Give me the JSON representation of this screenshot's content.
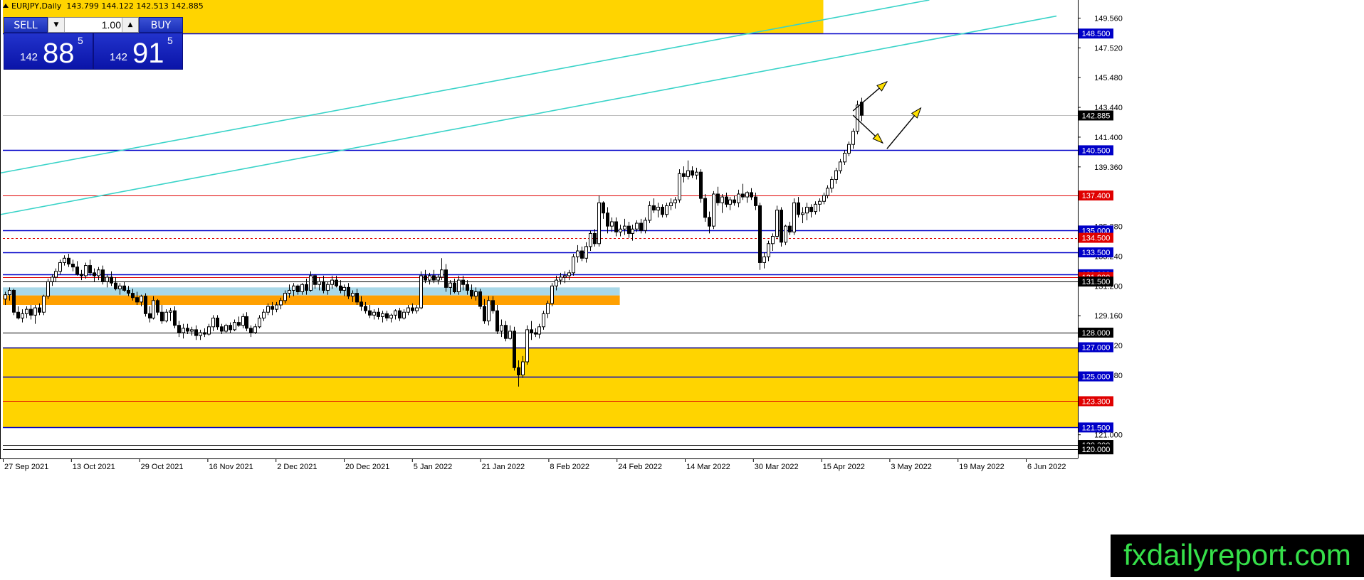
{
  "window": {
    "title": "EURJPY,Daily",
    "ohlc": "143.799 144.122 142.513 142.885"
  },
  "trade_panel": {
    "sell_label": "SELL",
    "buy_label": "BUY",
    "lot_size": "1.00",
    "bid": {
      "prefix": "142",
      "big": "88",
      "sup": "5"
    },
    "ask": {
      "prefix": "142",
      "big": "91",
      "sup": "5"
    }
  },
  "watermark": "fxdailyreport.com",
  "colors": {
    "zone_gold": "#ffd400",
    "zone_orange": "#ffa000",
    "zone_lightblue": "#a9d8e8",
    "line_blue": "#0000c8",
    "line_red": "#e00000",
    "channel_cyan": "#39d3c8",
    "label_blue_bg": "#0000c8",
    "label_red_bg": "#e00000",
    "label_black_bg": "#000000",
    "arrow_yellow": "#ffe000"
  },
  "chart_data": {
    "type": "candlestick",
    "symbol": "EURJPY",
    "timeframe": "Daily",
    "ylim": [
      119.6,
      150.8
    ],
    "x_ticks": [
      "27 Sep 2021",
      "13 Oct 2021",
      "29 Oct 2021",
      "16 Nov 2021",
      "2 Dec 2021",
      "20 Dec 2021",
      "5 Jan 2022",
      "21 Jan 2022",
      "8 Feb 2022",
      "24 Feb 2022",
      "14 Mar 2022",
      "30 Mar 2022",
      "15 Apr 2022",
      "3 May 2022",
      "19 May 2022",
      "6 Jun 2022"
    ],
    "y_ticks": [
      "149.560",
      "147.520",
      "145.480",
      "143.440",
      "141.400",
      "139.360",
      "135.280",
      "133.240",
      "131.200",
      "129.160",
      "127.120",
      "125.080",
      "121.000"
    ],
    "current_price": "142.885",
    "levels": [
      {
        "label": "148.500",
        "value": 148.5,
        "style": "blue"
      },
      {
        "label": "140.500",
        "value": 140.5,
        "style": "blue"
      },
      {
        "label": "137.400",
        "value": 137.4,
        "style": "red"
      },
      {
        "label": "135.000",
        "value": 135.0,
        "style": "blue"
      },
      {
        "label": "134.500",
        "value": 134.5,
        "style": "red-dash"
      },
      {
        "label": "133.500",
        "value": 133.5,
        "style": "blue"
      },
      {
        "label": "132.000",
        "value": 132.0,
        "style": "blue"
      },
      {
        "label": "131.800",
        "value": 131.8,
        "style": "red"
      },
      {
        "label": "131.500",
        "value": 131.5,
        "style": "black"
      },
      {
        "label": "128.000",
        "value": 128.0,
        "style": "black"
      },
      {
        "label": "127.000",
        "value": 127.0,
        "style": "blue"
      },
      {
        "label": "125.000",
        "value": 125.0,
        "style": "blue"
      },
      {
        "label": "123.300",
        "value": 123.3,
        "style": "red"
      },
      {
        "label": "121.500",
        "value": 121.5,
        "style": "blue"
      },
      {
        "label": "120.300",
        "value": 120.3,
        "style": "black"
      },
      {
        "label": "120.000",
        "value": 120.0,
        "style": "black"
      }
    ],
    "zones": [
      {
        "name": "top-gold",
        "from_price": 148.5,
        "to_price": 150.8,
        "color": "gold",
        "extends_to_day": 193
      },
      {
        "name": "bottom-gold",
        "from_price": 121.5,
        "to_price": 127.0,
        "color": "gold"
      },
      {
        "name": "light-blue-band",
        "from_price": 130.55,
        "to_price": 131.1,
        "color": "lightblue",
        "extends_to_day": 145
      },
      {
        "name": "orange-band",
        "from_price": 129.9,
        "to_price": 130.55,
        "color": "orange",
        "extends_to_day": 145
      }
    ],
    "channel_lines": [
      {
        "from": {
          "day": -1,
          "price": 138.95
        },
        "to": {
          "day": 218,
          "price": 150.8
        }
      },
      {
        "from": {
          "day": -1,
          "price": 136.1
        },
        "to": {
          "day": 248,
          "price": 149.7
        }
      }
    ],
    "arrows": [
      {
        "from": {
          "day": 200,
          "price": 143.2
        },
        "to": {
          "day": 208,
          "price": 145.2
        }
      },
      {
        "from": {
          "day": 200,
          "price": 142.9
        },
        "to": {
          "day": 207,
          "price": 141.0
        }
      },
      {
        "from": {
          "day": 208,
          "price": 140.6
        },
        "to": {
          "day": 216,
          "price": 143.4
        }
      }
    ],
    "candles": [
      [
        130.3,
        130.8,
        129.9,
        130.6
      ],
      [
        130.6,
        131.1,
        130.2,
        130.9
      ],
      [
        130.9,
        131.0,
        129.2,
        129.4
      ],
      [
        129.4,
        129.8,
        128.9,
        129.0
      ],
      [
        129.0,
        129.6,
        128.7,
        129.3
      ],
      [
        129.3,
        129.8,
        129.0,
        129.6
      ],
      [
        129.6,
        129.9,
        128.9,
        129.2
      ],
      [
        129.2,
        129.9,
        128.6,
        129.7
      ],
      [
        129.7,
        130.0,
        129.2,
        129.4
      ],
      [
        129.4,
        130.6,
        129.2,
        130.5
      ],
      [
        130.5,
        131.7,
        130.3,
        131.5
      ],
      [
        131.5,
        132.0,
        131.2,
        131.8
      ],
      [
        131.8,
        132.4,
        131.5,
        132.2
      ],
      [
        132.2,
        133.0,
        132.0,
        132.8
      ],
      [
        132.8,
        133.3,
        132.6,
        133.1
      ],
      [
        133.1,
        133.4,
        132.5,
        132.7
      ],
      [
        132.7,
        133.0,
        132.2,
        132.5
      ],
      [
        132.5,
        132.9,
        131.9,
        132.0
      ],
      [
        132.0,
        132.3,
        131.6,
        131.9
      ],
      [
        131.9,
        132.8,
        131.7,
        132.6
      ],
      [
        132.6,
        133.0,
        131.9,
        132.1
      ],
      [
        132.1,
        132.4,
        131.5,
        131.9
      ],
      [
        131.9,
        132.5,
        131.6,
        132.3
      ],
      [
        132.3,
        132.6,
        131.3,
        131.5
      ],
      [
        131.5,
        132.0,
        131.1,
        131.8
      ],
      [
        131.8,
        132.2,
        131.2,
        131.4
      ],
      [
        131.4,
        131.8,
        130.9,
        131.0
      ],
      [
        131.0,
        131.4,
        130.6,
        131.2
      ],
      [
        131.2,
        131.5,
        130.8,
        130.9
      ],
      [
        130.9,
        131.2,
        130.5,
        130.7
      ],
      [
        130.7,
        131.0,
        130.2,
        130.4
      ],
      [
        130.4,
        130.8,
        129.9,
        130.1
      ],
      [
        130.1,
        130.6,
        129.8,
        130.5
      ],
      [
        130.5,
        130.7,
        129.1,
        129.3
      ],
      [
        129.3,
        129.8,
        128.7,
        129.0
      ],
      [
        129.0,
        130.5,
        128.9,
        130.2
      ],
      [
        130.2,
        130.3,
        129.2,
        129.4
      ],
      [
        129.4,
        129.9,
        128.6,
        128.8
      ],
      [
        128.8,
        129.6,
        128.7,
        129.4
      ],
      [
        129.4,
        129.7,
        128.8,
        129.5
      ],
      [
        129.5,
        129.8,
        128.3,
        128.5
      ],
      [
        128.5,
        128.8,
        127.7,
        128.0
      ],
      [
        128.0,
        128.6,
        127.6,
        128.3
      ],
      [
        128.3,
        128.6,
        127.9,
        128.1
      ],
      [
        128.1,
        128.4,
        127.8,
        128.2
      ],
      [
        128.2,
        128.5,
        127.5,
        127.8
      ],
      [
        127.8,
        128.2,
        127.5,
        128.0
      ],
      [
        128.0,
        128.3,
        127.7,
        127.9
      ],
      [
        127.9,
        128.6,
        127.8,
        128.4
      ],
      [
        128.4,
        129.2,
        128.1,
        129.0
      ],
      [
        129.0,
        129.2,
        128.2,
        128.4
      ],
      [
        128.4,
        128.6,
        127.9,
        128.1
      ],
      [
        128.1,
        128.6,
        128.0,
        128.5
      ],
      [
        128.5,
        128.7,
        128.0,
        128.2
      ],
      [
        128.2,
        128.9,
        128.1,
        128.7
      ],
      [
        128.7,
        129.1,
        128.4,
        128.5
      ],
      [
        128.5,
        129.3,
        128.3,
        129.1
      ],
      [
        129.1,
        129.4,
        128.1,
        128.3
      ],
      [
        128.3,
        128.5,
        127.7,
        128.0
      ],
      [
        128.0,
        128.6,
        127.9,
        128.4
      ],
      [
        128.4,
        129.2,
        128.3,
        129.0
      ],
      [
        129.0,
        129.6,
        128.8,
        129.4
      ],
      [
        129.4,
        130.0,
        129.2,
        129.8
      ],
      [
        129.8,
        130.1,
        129.2,
        129.6
      ],
      [
        129.6,
        130.1,
        129.4,
        129.9
      ],
      [
        129.9,
        130.4,
        129.6,
        130.2
      ],
      [
        130.2,
        130.9,
        130.0,
        130.7
      ],
      [
        130.7,
        131.3,
        130.4,
        130.9
      ],
      [
        130.9,
        131.4,
        130.5,
        131.2
      ],
      [
        131.2,
        131.3,
        130.6,
        130.8
      ],
      [
        130.8,
        131.4,
        130.6,
        131.3
      ],
      [
        131.3,
        131.7,
        130.6,
        130.9
      ],
      [
        130.9,
        132.2,
        130.8,
        131.9
      ],
      [
        131.9,
        132.0,
        131.0,
        131.3
      ],
      [
        131.3,
        131.8,
        130.9,
        131.5
      ],
      [
        131.5,
        131.9,
        130.7,
        130.9
      ],
      [
        130.9,
        131.5,
        130.6,
        131.3
      ],
      [
        131.3,
        131.9,
        131.0,
        131.6
      ],
      [
        131.6,
        131.9,
        131.1,
        131.2
      ],
      [
        131.2,
        131.6,
        130.7,
        130.9
      ],
      [
        130.9,
        131.3,
        130.5,
        131.1
      ],
      [
        131.1,
        131.4,
        130.3,
        130.5
      ],
      [
        130.5,
        130.9,
        130.1,
        130.7
      ],
      [
        130.7,
        131.0,
        129.9,
        130.1
      ],
      [
        130.1,
        130.5,
        129.5,
        129.8
      ],
      [
        129.8,
        130.1,
        129.3,
        129.5
      ],
      [
        129.5,
        129.9,
        129.0,
        129.2
      ],
      [
        129.2,
        129.6,
        128.9,
        129.4
      ],
      [
        129.4,
        129.7,
        128.9,
        129.1
      ],
      [
        129.1,
        129.5,
        128.7,
        129.3
      ],
      [
        129.3,
        129.5,
        128.8,
        129.0
      ],
      [
        129.0,
        129.3,
        128.7,
        129.2
      ],
      [
        129.2,
        129.6,
        128.9,
        129.5
      ],
      [
        129.5,
        129.7,
        128.8,
        129.0
      ],
      [
        129.0,
        129.6,
        128.9,
        129.4
      ],
      [
        129.4,
        129.9,
        129.2,
        129.7
      ],
      [
        129.7,
        130.0,
        129.3,
        129.5
      ],
      [
        129.5,
        129.9,
        129.3,
        129.7
      ],
      [
        129.7,
        132.2,
        129.6,
        131.9
      ],
      [
        131.9,
        132.3,
        131.4,
        131.6
      ],
      [
        131.6,
        132.1,
        131.3,
        131.9
      ],
      [
        131.9,
        132.3,
        131.4,
        131.6
      ],
      [
        131.6,
        132.0,
        131.3,
        131.8
      ],
      [
        131.8,
        133.1,
        131.6,
        132.3
      ],
      [
        132.3,
        132.7,
        130.8,
        131.1
      ],
      [
        131.1,
        131.6,
        130.6,
        131.4
      ],
      [
        131.4,
        131.7,
        130.7,
        130.8
      ],
      [
        130.8,
        131.9,
        130.6,
        131.6
      ],
      [
        131.6,
        131.9,
        130.9,
        131.3
      ],
      [
        131.3,
        131.6,
        130.6,
        130.9
      ],
      [
        130.9,
        131.3,
        130.3,
        130.5
      ],
      [
        130.5,
        131.1,
        130.2,
        130.8
      ],
      [
        130.8,
        131.0,
        129.6,
        129.8
      ],
      [
        129.8,
        130.3,
        128.6,
        128.8
      ],
      [
        128.8,
        130.5,
        128.5,
        130.2
      ],
      [
        130.2,
        130.5,
        129.3,
        129.5
      ],
      [
        129.5,
        129.9,
        127.9,
        128.1
      ],
      [
        128.1,
        128.9,
        127.7,
        128.5
      ],
      [
        128.5,
        128.8,
        127.4,
        127.6
      ],
      [
        127.6,
        128.5,
        127.5,
        128.1
      ],
      [
        128.1,
        128.4,
        125.4,
        125.6
      ],
      [
        125.6,
        126.1,
        124.3,
        125.1
      ],
      [
        125.1,
        126.4,
        124.9,
        126.0
      ],
      [
        126.0,
        128.5,
        125.8,
        128.2
      ],
      [
        128.2,
        128.8,
        127.5,
        128.0
      ],
      [
        128.0,
        128.3,
        127.7,
        127.9
      ],
      [
        127.9,
        128.6,
        127.6,
        128.4
      ],
      [
        128.4,
        129.5,
        128.2,
        129.3
      ],
      [
        129.3,
        130.2,
        129.0,
        130.0
      ],
      [
        130.0,
        131.4,
        129.8,
        131.2
      ],
      [
        131.2,
        131.9,
        130.9,
        131.6
      ],
      [
        131.6,
        132.1,
        131.3,
        131.8
      ],
      [
        131.8,
        132.2,
        131.4,
        131.9
      ],
      [
        131.9,
        132.3,
        131.6,
        132.1
      ],
      [
        132.1,
        133.4,
        131.9,
        133.2
      ],
      [
        133.2,
        134.0,
        132.8,
        133.6
      ],
      [
        133.6,
        133.9,
        132.9,
        133.1
      ],
      [
        133.1,
        134.2,
        132.8,
        133.9
      ],
      [
        133.9,
        135.0,
        133.6,
        134.8
      ],
      [
        134.8,
        135.1,
        133.9,
        134.1
      ],
      [
        134.1,
        137.4,
        133.9,
        136.9
      ],
      [
        136.9,
        137.0,
        135.8,
        136.2
      ],
      [
        136.2,
        136.6,
        134.8,
        135.3
      ],
      [
        135.3,
        135.9,
        134.9,
        135.6
      ],
      [
        135.6,
        135.9,
        134.6,
        134.9
      ],
      [
        134.9,
        135.4,
        134.6,
        135.1
      ],
      [
        135.1,
        135.8,
        134.7,
        135.3
      ],
      [
        135.3,
        135.6,
        134.5,
        134.8
      ],
      [
        134.8,
        135.4,
        134.3,
        135.1
      ],
      [
        135.1,
        135.7,
        134.9,
        135.5
      ],
      [
        135.5,
        135.8,
        134.8,
        135.0
      ],
      [
        135.0,
        135.9,
        134.8,
        135.7
      ],
      [
        135.7,
        137.0,
        135.5,
        136.7
      ],
      [
        136.7,
        137.2,
        136.2,
        136.4
      ],
      [
        136.4,
        136.9,
        135.9,
        136.6
      ],
      [
        136.6,
        136.8,
        135.9,
        136.1
      ],
      [
        136.1,
        136.9,
        135.9,
        136.7
      ],
      [
        136.7,
        137.2,
        136.4,
        136.9
      ],
      [
        136.9,
        137.3,
        136.5,
        137.1
      ],
      [
        137.1,
        139.2,
        136.9,
        138.9
      ],
      [
        138.9,
        139.4,
        138.3,
        138.7
      ],
      [
        138.7,
        139.8,
        138.5,
        139.1
      ],
      [
        139.1,
        139.4,
        138.6,
        138.8
      ],
      [
        138.8,
        139.3,
        138.5,
        139.0
      ],
      [
        139.0,
        139.2,
        136.9,
        137.2
      ],
      [
        137.2,
        137.5,
        135.6,
        135.9
      ],
      [
        135.9,
        136.3,
        134.8,
        135.3
      ],
      [
        135.3,
        137.7,
        135.1,
        137.5
      ],
      [
        137.5,
        138.0,
        136.7,
        136.9
      ],
      [
        136.9,
        137.5,
        136.2,
        137.3
      ],
      [
        137.3,
        137.6,
        136.6,
        136.8
      ],
      [
        136.8,
        137.3,
        136.4,
        137.1
      ],
      [
        137.1,
        137.4,
        136.7,
        136.9
      ],
      [
        136.9,
        137.8,
        136.6,
        137.5
      ],
      [
        137.5,
        138.2,
        137.1,
        137.3
      ],
      [
        137.3,
        137.7,
        136.9,
        137.6
      ],
      [
        137.6,
        137.9,
        137.1,
        137.3
      ],
      [
        137.3,
        137.6,
        136.4,
        136.7
      ],
      [
        136.7,
        136.9,
        132.3,
        132.8
      ],
      [
        132.8,
        133.5,
        132.4,
        133.2
      ],
      [
        133.2,
        134.3,
        132.9,
        134.1
      ],
      [
        134.1,
        134.8,
        133.6,
        134.6
      ],
      [
        134.6,
        136.7,
        134.4,
        136.4
      ],
      [
        136.4,
        136.6,
        133.9,
        134.2
      ],
      [
        134.2,
        135.4,
        134.0,
        135.3
      ],
      [
        135.3,
        135.6,
        134.7,
        134.9
      ],
      [
        134.9,
        137.2,
        134.7,
        136.9
      ],
      [
        136.9,
        137.3,
        135.9,
        136.1
      ],
      [
        136.1,
        136.6,
        135.5,
        136.2
      ],
      [
        136.2,
        136.9,
        135.7,
        136.6
      ],
      [
        136.6,
        136.8,
        135.9,
        136.3
      ],
      [
        136.3,
        137.0,
        136.1,
        136.8
      ],
      [
        136.8,
        137.2,
        136.3,
        137.0
      ],
      [
        137.0,
        137.6,
        136.8,
        137.4
      ],
      [
        137.4,
        138.1,
        137.2,
        137.9
      ],
      [
        137.9,
        138.7,
        137.6,
        138.5
      ],
      [
        138.5,
        139.3,
        138.2,
        139.1
      ],
      [
        139.1,
        139.9,
        138.9,
        139.7
      ],
      [
        139.7,
        140.5,
        139.5,
        140.3
      ],
      [
        140.3,
        141.1,
        140.1,
        140.9
      ],
      [
        140.9,
        142.0,
        140.6,
        141.8
      ],
      [
        141.8,
        143.9,
        141.6,
        143.6
      ],
      [
        143.8,
        144.1,
        142.5,
        142.9
      ]
    ]
  }
}
